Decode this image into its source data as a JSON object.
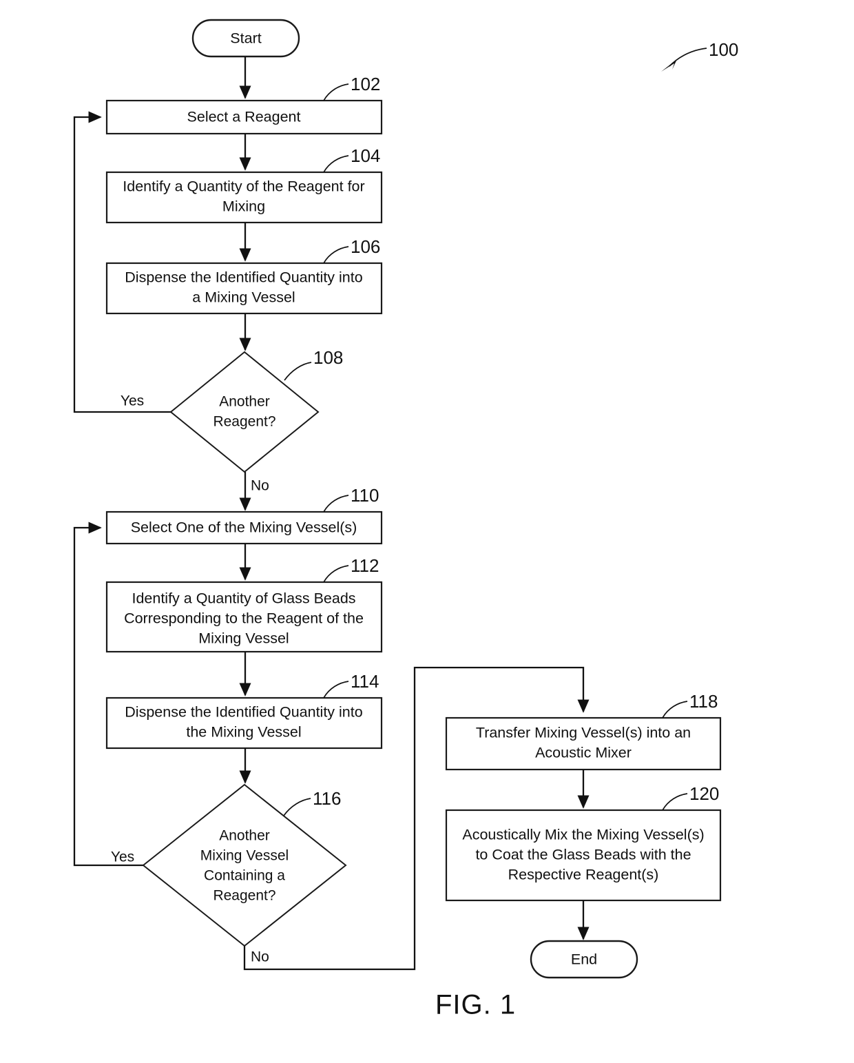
{
  "figure": {
    "caption": "FIG. 1",
    "overall_ref": "100"
  },
  "terminators": {
    "start": "Start",
    "end": "End"
  },
  "branch_labels": {
    "yes": "Yes",
    "no": "No"
  },
  "steps": [
    {
      "ref": "102",
      "lines": [
        "Select a Reagent"
      ]
    },
    {
      "ref": "104",
      "lines": [
        "Identify a Quantity of the Reagent for",
        "Mixing"
      ]
    },
    {
      "ref": "106",
      "lines": [
        "Dispense the Identified Quantity into",
        "a Mixing Vessel"
      ]
    },
    {
      "ref": "110",
      "lines": [
        "Select One of the Mixing Vessel(s)"
      ]
    },
    {
      "ref": "112",
      "lines": [
        "Identify a Quantity of Glass Beads",
        "Corresponding to the Reagent of the",
        "Mixing Vessel"
      ]
    },
    {
      "ref": "114",
      "lines": [
        "Dispense the Identified Quantity into",
        "the Mixing Vessel"
      ]
    },
    {
      "ref": "118",
      "lines": [
        "Transfer Mixing Vessel(s) into an",
        "Acoustic Mixer"
      ]
    },
    {
      "ref": "120",
      "lines": [
        "Acoustically Mix the Mixing Vessel(s)",
        "to Coat the Glass Beads with the",
        "Respective Reagent(s)"
      ]
    }
  ],
  "decisions": [
    {
      "ref": "108",
      "lines": [
        "Another",
        "Reagent?"
      ],
      "yes": "Yes",
      "no": "No"
    },
    {
      "ref": "116",
      "lines": [
        "Another",
        "Mixing Vessel",
        "Containing a",
        "Reagent?"
      ],
      "yes": "Yes",
      "no": "No"
    }
  ],
  "colors": {
    "ink": "#111111",
    "paper": "#ffffff"
  }
}
